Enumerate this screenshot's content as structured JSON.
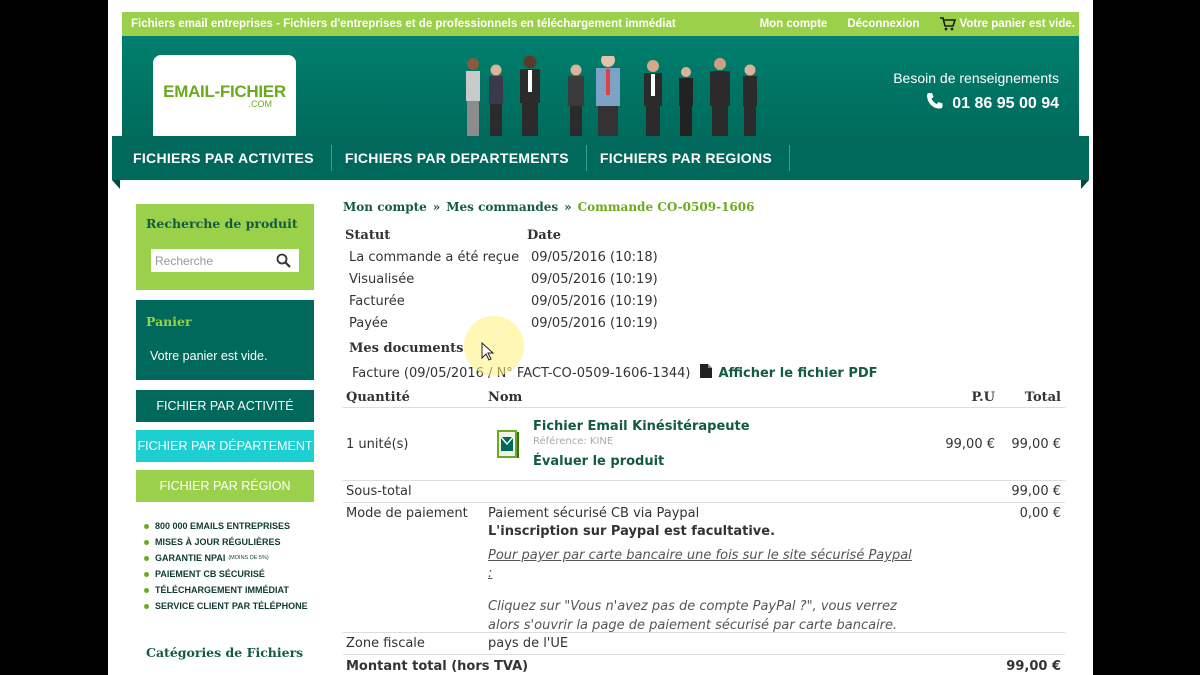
{
  "topbar": {
    "tagline": "Fichiers email entreprises - Fichiers d'entreprises et de professionnels en téléchargement immédiat",
    "account": "Mon compte",
    "logout": "Déconnexion",
    "cart": "Votre panier est vide."
  },
  "header": {
    "logo_main": "EMAIL-FICHIER",
    "logo_sub": ".COM",
    "help": "Besoin de renseignements",
    "phone": "01 86 95 00 94"
  },
  "nav": {
    "items": [
      "FICHIERS PAR ACTIVITES",
      "FICHIERS PAR DEPARTEMENTS",
      "FICHIERS PAR REGIONS"
    ]
  },
  "sidebar": {
    "search_title": "Recherche de produit",
    "search_placeholder": "Recherche",
    "cart_title": "Panier",
    "cart_text": "Votre panier est vide.",
    "buttons": [
      "FICHIER PAR ACTIVITÉ",
      "FICHIER PAR DÉPARTEMENT",
      "FICHIER PAR RÉGION"
    ],
    "features": [
      "800 000 EMAILS ENTREPRISES",
      "MISES À JOUR RÉGULIÈRES",
      "GARANTIE NPAI",
      "PAIEMENT CB SÉCURISÉ",
      "TÉLÉCHARGEMENT IMMÉDIAT",
      "SERVICE CLIENT PAR TÉLÉPHONE"
    ],
    "npai_note": "(MOINS DE 5%)",
    "categories_title": "Catégories de Fichiers"
  },
  "breadcrumb": {
    "account": "Mon compte",
    "orders": "Mes commandes",
    "current": "Commande CO-0509-1606",
    "sep": "»"
  },
  "status": {
    "header_status": "Statut",
    "header_date": "Date",
    "rows": [
      {
        "label": "La commande a été reçue",
        "date": "09/05/2016 (10:18)"
      },
      {
        "label": "Visualisée",
        "date": "09/05/2016 (10:19)"
      },
      {
        "label": "Facturée",
        "date": "09/05/2016 (10:19)"
      },
      {
        "label": "Payée",
        "date": "09/05/2016 (10:19)"
      }
    ]
  },
  "documents": {
    "title": "Mes documents",
    "invoice": "Facture (09/05/2016 / N° FACT-CO-0509-1606-1344)",
    "pdf_link": "Afficher le fichier PDF"
  },
  "order": {
    "headers": {
      "qty": "Quantité",
      "name": "Nom",
      "pu": "P.U",
      "total": "Total"
    },
    "item": {
      "qty": "1 unité(s)",
      "name": "Fichier Email Kinésitérapeute",
      "ref": "Référence: KINE",
      "review": "Évaluer le produit",
      "pu": "99,00 €",
      "total": "99,00 €"
    },
    "subtotal_label": "Sous-total",
    "subtotal": "99,00 €",
    "payment_label": "Mode de paiement",
    "payment_method": "Paiement sécurisé CB via Paypal",
    "payment_note": "L'inscription sur Paypal est facultative.",
    "payment_hint": "Pour payer par carte bancaire une fois sur le site sécurisé Paypal :",
    "payment_instructions": "Cliquez sur \"Vous n'avez pas de compte PayPal ?\", vous verrez alors s'ouvrir la page de paiement sécurisé par carte bancaire.",
    "payment_amount": "0,00 €",
    "tax_label": "Zone fiscale",
    "tax_value": "pays de l'UE",
    "total_label": "Montant total (hors TVA)",
    "total_amount": "99,00 €"
  },
  "colors": {
    "green_light": "#9bd04a",
    "green_dark": "#00695b",
    "cyan": "#1dcfd0",
    "link": "#135a43"
  }
}
